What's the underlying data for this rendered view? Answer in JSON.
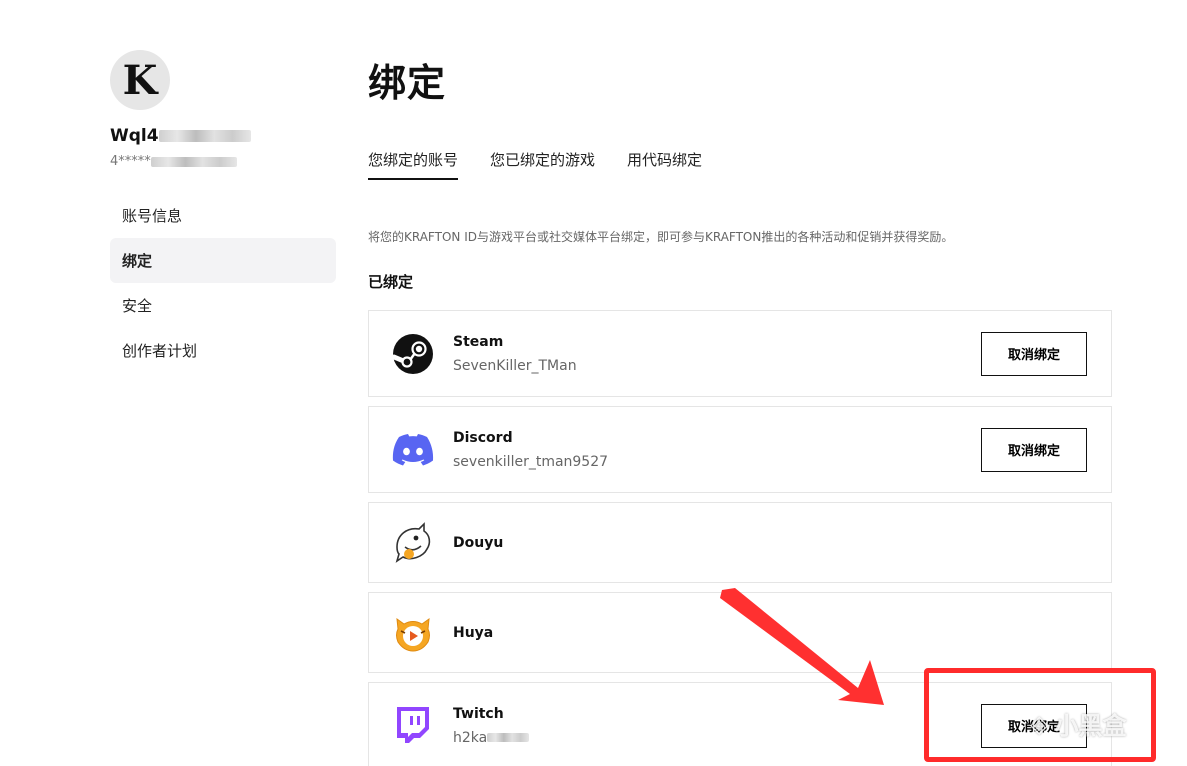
{
  "sidebar": {
    "avatar_letter": "K",
    "username": "Wql4",
    "user_id": "4*****",
    "menu": [
      {
        "label": "账号信息",
        "active": false
      },
      {
        "label": "绑定",
        "active": true
      },
      {
        "label": "安全",
        "active": false
      },
      {
        "label": "创作者计划",
        "active": false
      }
    ]
  },
  "main": {
    "title": "绑定",
    "tabs": [
      {
        "label": "您绑定的账号",
        "active": true
      },
      {
        "label": "您已绑定的游戏",
        "active": false
      },
      {
        "label": "用代码绑定",
        "active": false
      }
    ],
    "description": "将您的KRAFTON ID与游戏平台或社交媒体平台绑定，即可参与KRAFTON推出的各种活动和促销并获得奖励。",
    "section_label": "已绑定",
    "unbind_label": "取消绑定",
    "accounts": [
      {
        "platform": "Steam",
        "account": "SevenKiller_TMan",
        "icon": "steam-icon",
        "bound": true
      },
      {
        "platform": "Discord",
        "account": "sevenkiller_tman9527",
        "icon": "discord-icon",
        "bound": true
      },
      {
        "platform": "Douyu",
        "account": "",
        "icon": "douyu-icon",
        "bound": false
      },
      {
        "platform": "Huya",
        "account": "",
        "icon": "huya-icon",
        "bound": false
      },
      {
        "platform": "Twitch",
        "account": "h2ka",
        "icon": "twitch-icon",
        "bound": true
      }
    ]
  },
  "colors": {
    "annotation": "#ff2b2b",
    "discord": "#5865f2",
    "twitch": "#9146ff",
    "huya": "#f5a623"
  },
  "watermark": "小黑盒"
}
